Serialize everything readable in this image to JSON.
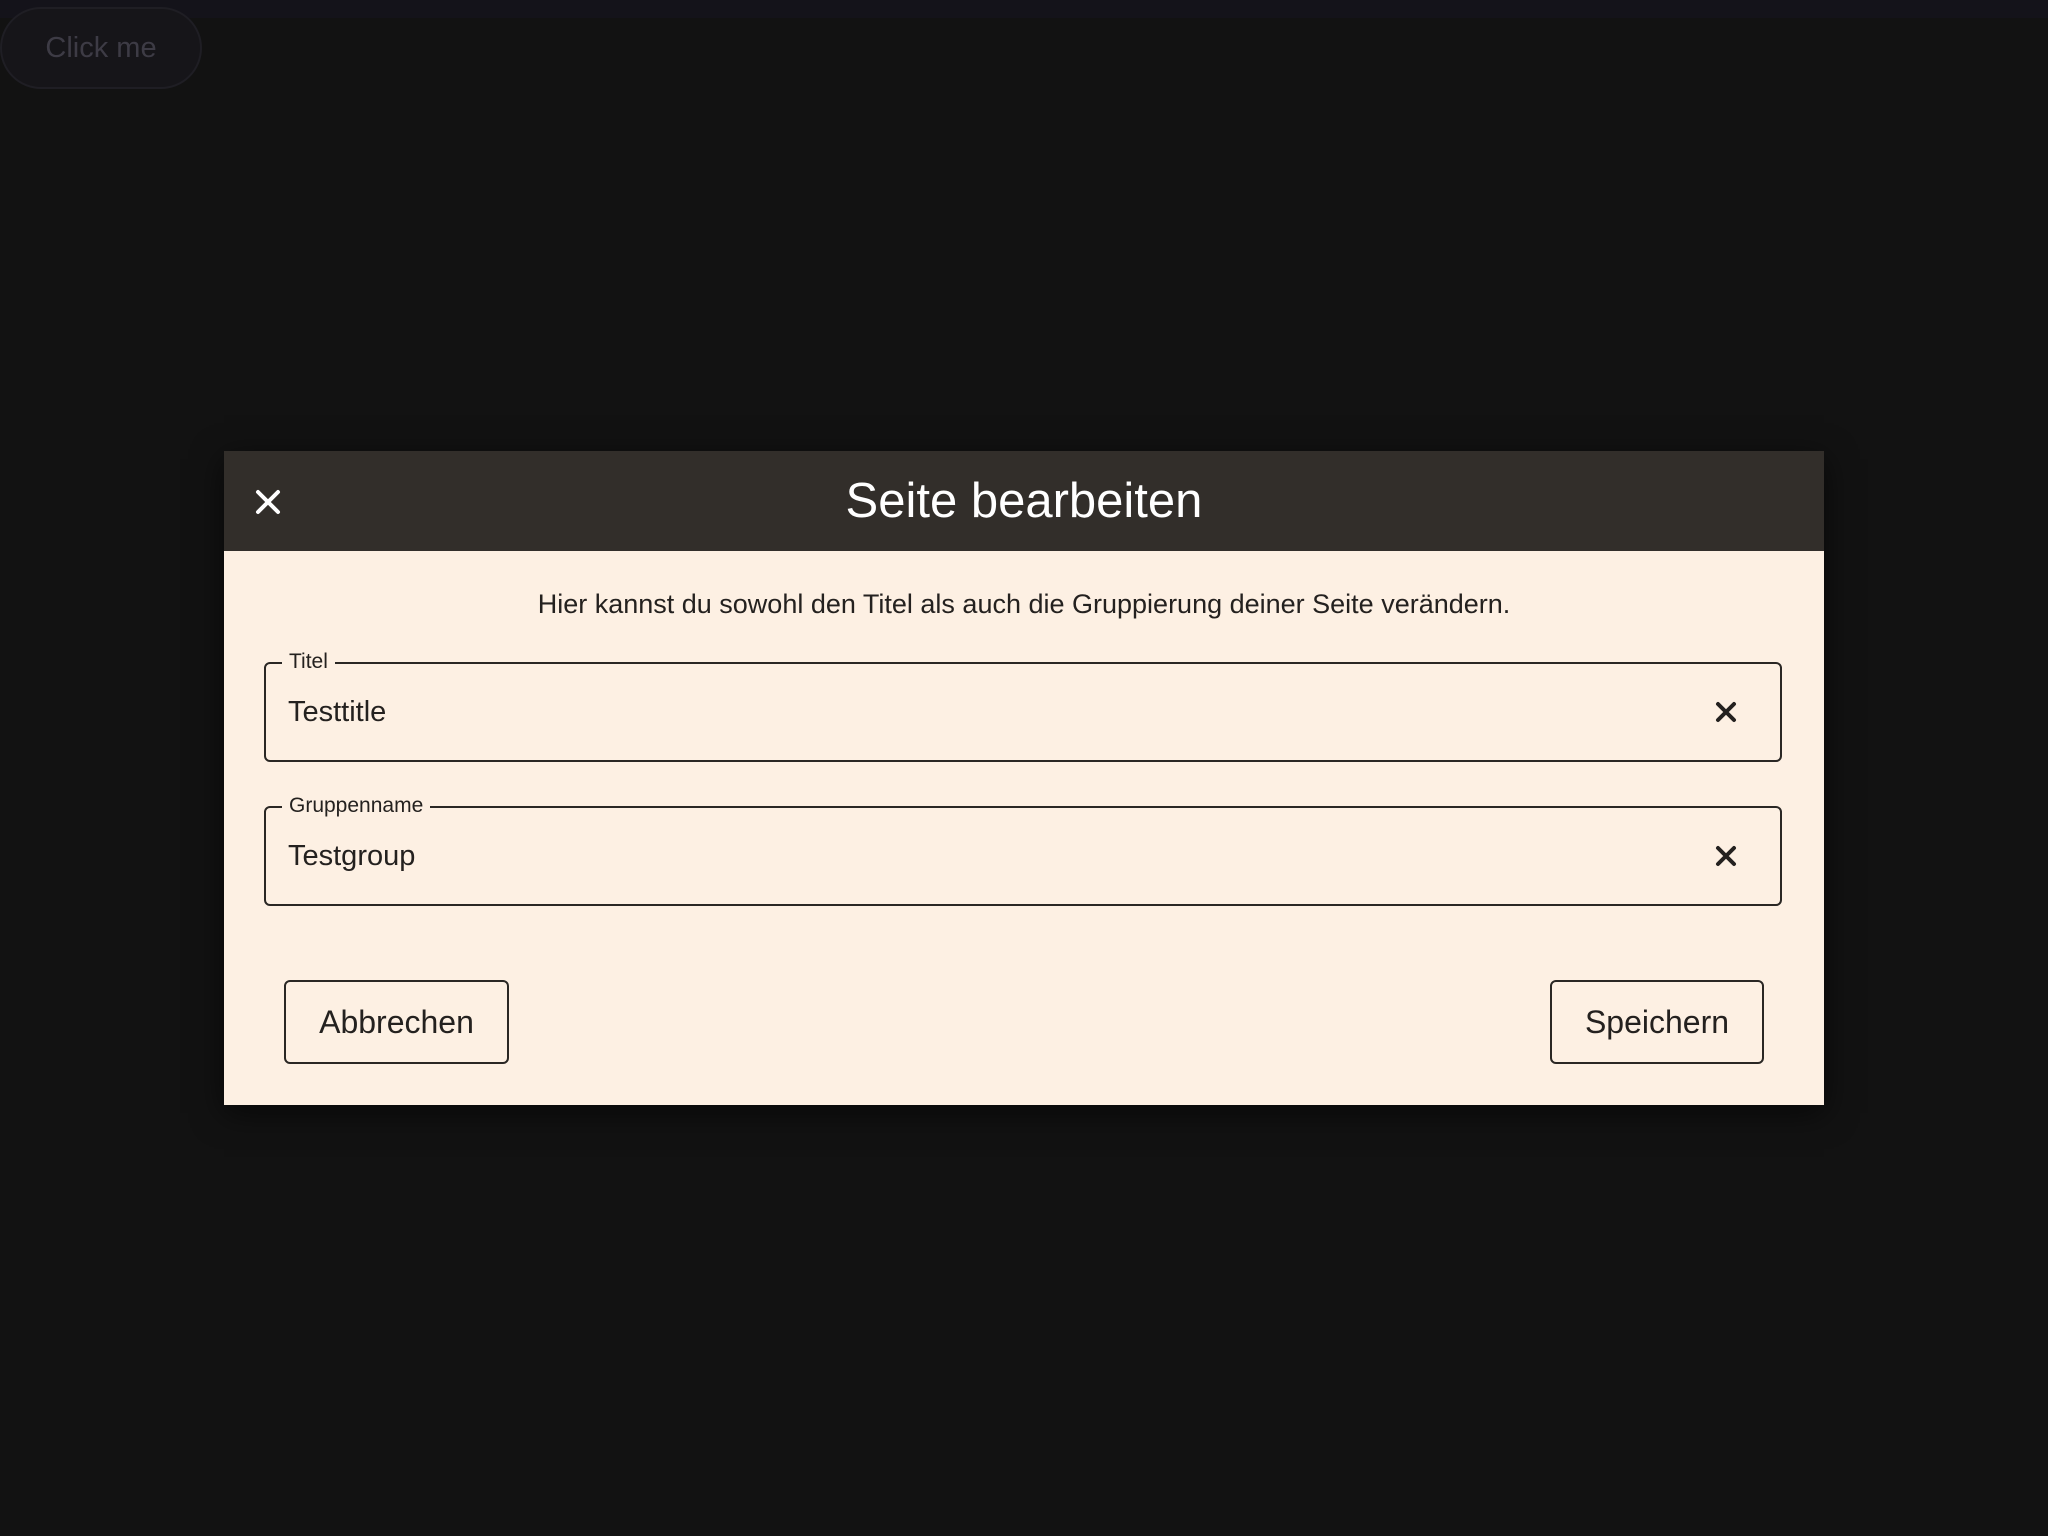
{
  "background": {
    "button_label": "Click me"
  },
  "dialog": {
    "title": "Seite bearbeiten",
    "description": "Hier kannst du sowohl den Titel als auch die Gruppierung deiner Seite verändern.",
    "fields": {
      "title": {
        "label": "Titel",
        "value": "Testtitle"
      },
      "group": {
        "label": "Gruppenname",
        "value": "Testgroup"
      }
    },
    "buttons": {
      "cancel": "Abbrechen",
      "save": "Speichern"
    }
  },
  "icons": {
    "dialog_close": "close-icon",
    "field_clear": "close-icon"
  },
  "colors": {
    "page_background": "#121212",
    "dialog_header": "#322e2a",
    "dialog_body": "#fdf0e3",
    "text_dark": "#24211f",
    "text_light": "#ffffff"
  }
}
